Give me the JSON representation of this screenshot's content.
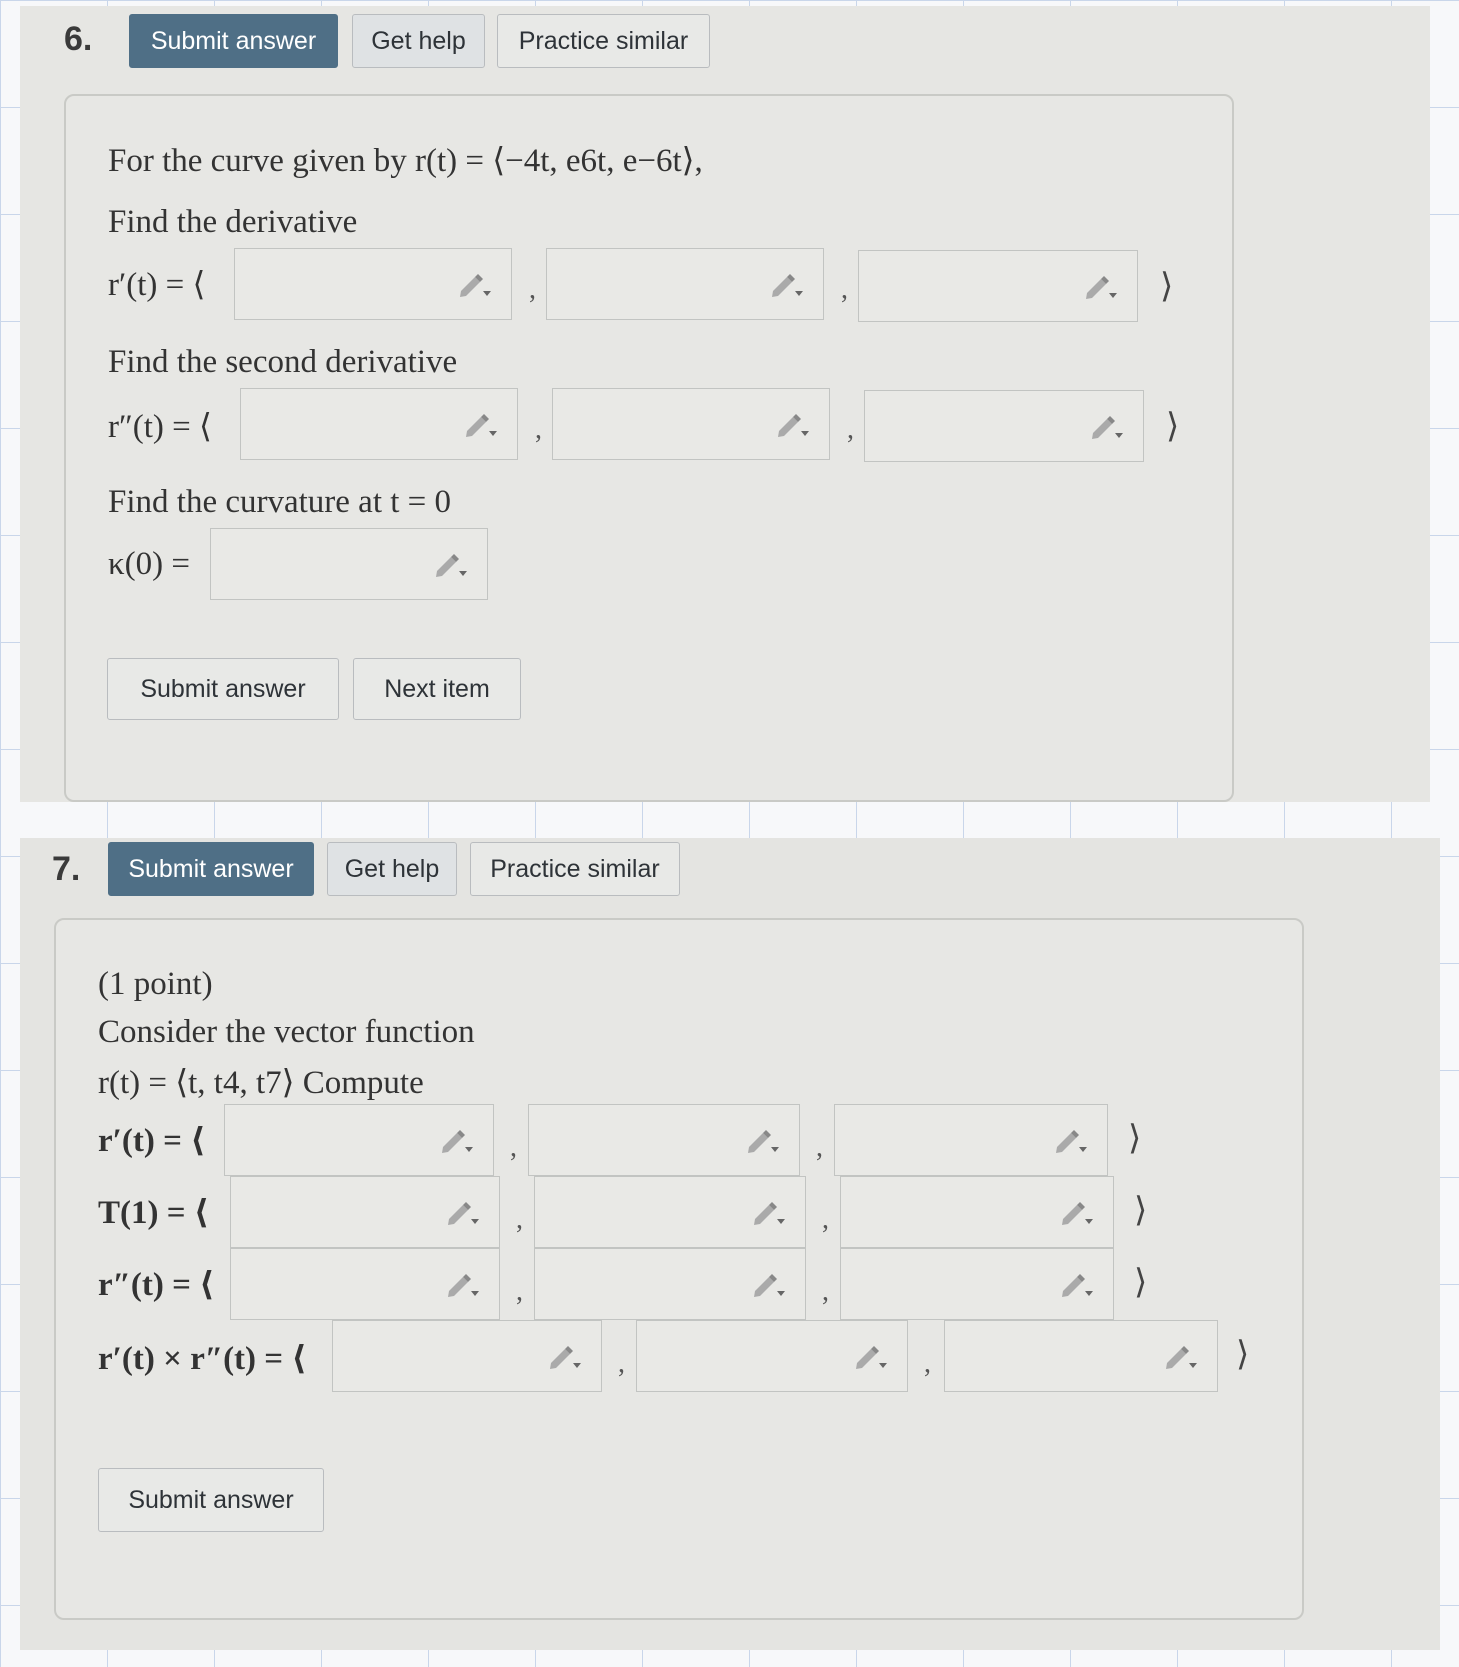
{
  "q6": {
    "number": "6.",
    "top_buttons": [
      "Submit answer",
      "Get help",
      "Practice similar"
    ],
    "intro": "For the curve given by r(t) = ⟨−4t, e6t, e−6t⟩,",
    "find_derivative": "Find the derivative",
    "r_prime_label": "r′(t) = ⟨",
    "find_second": "Find the second derivative",
    "r_dprime_label": "r″(t) = ⟨",
    "find_curvature": "Find the curvature at t = 0",
    "kappa_label": "κ(0) =",
    "bottom_buttons": [
      "Submit answer",
      "Next item"
    ]
  },
  "q7": {
    "number": "7.",
    "top_buttons": [
      "Submit answer",
      "Get help",
      "Practice similar"
    ],
    "points": "(1 point)",
    "consider": "Consider the vector function",
    "function": "r(t) = ⟨t, t4, t7⟩ Compute",
    "rows": [
      {
        "label": "r′(t) = ⟨"
      },
      {
        "label": "T(1) = ⟨"
      },
      {
        "label": "r″(t) = ⟨"
      },
      {
        "label": "r′(t) × r″(t) = ⟨"
      }
    ],
    "bottom_button": "Submit answer"
  },
  "symbols": {
    "comma": ",",
    "close": "⟩"
  },
  "icon": "pencil-dropdown-icon",
  "colors": {
    "primary_button": "#4f6f86",
    "panel_bg": "#e7e7e4"
  }
}
